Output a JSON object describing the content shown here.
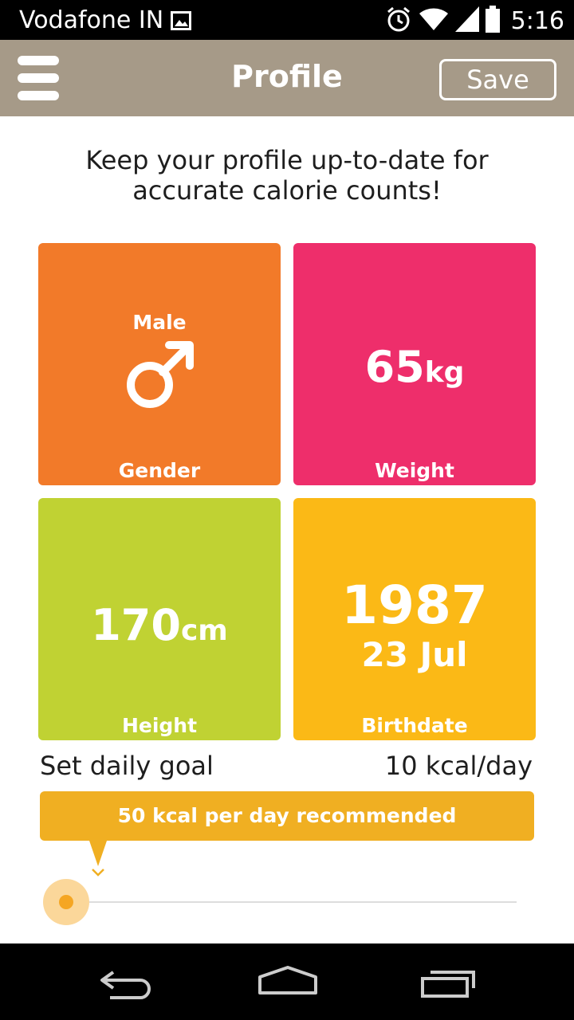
{
  "status_bar": {
    "carrier": "Vodafone IN",
    "time": "5:16",
    "icons": [
      "image-icon",
      "alarm-icon",
      "wifi-icon",
      "signal-icon",
      "battery-icon"
    ]
  },
  "app_bar": {
    "title": "Profile",
    "save_label": "Save",
    "color": "#a69a88"
  },
  "intro_text": "Keep your profile up-to-date for accurate calorie counts!",
  "tiles": {
    "gender": {
      "value": "Male",
      "label": "Gender",
      "icon": "male-icon",
      "color": "#f27a29"
    },
    "weight": {
      "number": "65",
      "unit": "kg",
      "label": "Weight",
      "color": "#ee2e6b"
    },
    "height": {
      "number": "170",
      "unit": "cm",
      "label": "Height",
      "color": "#c0d233"
    },
    "birthdate": {
      "year": "1987",
      "day_month": "23 Jul",
      "label": "Birthdate",
      "color": "#fbb916"
    }
  },
  "goal": {
    "label": "Set daily goal",
    "value": "10 kcal/day",
    "recommendation": "50 kcal per day recommended",
    "slider_accent": "#f5a623"
  },
  "nav_bar": {
    "icons": [
      "back-icon",
      "home-icon",
      "recent-apps-icon"
    ]
  }
}
